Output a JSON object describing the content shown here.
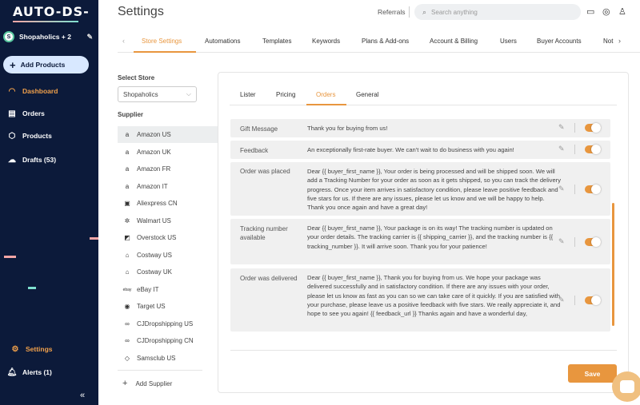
{
  "sidebar": {
    "logo": "AUTO-DS-",
    "store": {
      "avatar": "S",
      "name": "Shopaholics + 2"
    },
    "add_products": "Add Products",
    "nav": [
      {
        "label": "Dashboard",
        "icon": "dashboard-icon",
        "active": true
      },
      {
        "label": "Orders",
        "icon": "orders-icon"
      },
      {
        "label": "Products",
        "icon": "products-icon"
      },
      {
        "label": "Drafts (53)",
        "icon": "drafts-icon"
      }
    ],
    "bottom_nav": [
      {
        "label": "Settings",
        "icon": "settings-icon",
        "active": true
      },
      {
        "label": "Alerts (1)",
        "icon": "alerts-icon"
      }
    ],
    "colors": {
      "background": "#0c1a3a",
      "accent": "#f0a04b"
    }
  },
  "header": {
    "title": "Settings",
    "referrals": "Referrals",
    "search_placeholder": "Search anything"
  },
  "top_tabs": [
    {
      "label": "Store Settings",
      "active": true
    },
    {
      "label": "Automations"
    },
    {
      "label": "Templates"
    },
    {
      "label": "Keywords"
    },
    {
      "label": "Plans & Add-ons"
    },
    {
      "label": "Account & Billing"
    },
    {
      "label": "Users"
    },
    {
      "label": "Buyer Accounts"
    },
    {
      "label": "Not"
    }
  ],
  "store_column": {
    "select_label": "Select Store",
    "selected_store": "Shopaholics",
    "supplier_label": "Supplier",
    "suppliers": [
      {
        "name": "Amazon US",
        "icon": "amazon-icon",
        "active": true
      },
      {
        "name": "Amazon UK",
        "icon": "amazon-icon"
      },
      {
        "name": "Amazon FR",
        "icon": "amazon-icon"
      },
      {
        "name": "Amazon IT",
        "icon": "amazon-icon"
      },
      {
        "name": "Aliexpress CN",
        "icon": "aliexpress-icon"
      },
      {
        "name": "Walmart US",
        "icon": "walmart-icon"
      },
      {
        "name": "Overstock US",
        "icon": "overstock-icon"
      },
      {
        "name": "Costway US",
        "icon": "costway-icon"
      },
      {
        "name": "Costway UK",
        "icon": "costway-icon"
      },
      {
        "name": "eBay IT",
        "icon": "ebay-icon"
      },
      {
        "name": "Target US",
        "icon": "target-icon"
      },
      {
        "name": "CJDropshipping US",
        "icon": "cj-icon"
      },
      {
        "name": "CJDropshipping CN",
        "icon": "cj-icon"
      },
      {
        "name": "Samsclub US",
        "icon": "samsclub-icon"
      }
    ],
    "add_supplier": "Add Supplier"
  },
  "sub_tabs": [
    {
      "label": "Lister"
    },
    {
      "label": "Pricing"
    },
    {
      "label": "Orders",
      "active": true
    },
    {
      "label": "General"
    }
  ],
  "messages": [
    {
      "label": "Gift Message",
      "text": "Thank you for buying from us!",
      "enabled": true
    },
    {
      "label": "Feedback",
      "text": "An exceptionally first-rate buyer. We can't wait to do business with you again!",
      "enabled": true
    },
    {
      "label": "Order was placed",
      "text": "Dear {{ buyer_first_name }}, Your order is being processed and will be shipped soon. We will add a Tracking Number for your order as soon as it gets shipped, so you can track the delivery progress. Once your item arrives in satisfactory condition, please leave positive feedback and five stars for us. If there are any issues, please let us know and we will be happy to help. Thank you once again and have a great day!",
      "enabled": true
    },
    {
      "label": "Tracking number available",
      "text": "Dear {{ buyer_first_name }}, Your package is on its way! The tracking number is updated on your order details. The tracking carrier is {{ shipping_carrier }}, and the tracking number is {{ tracking_number }}. It will arrive soon. Thank you for your patience!",
      "enabled": true
    },
    {
      "label": "Order was delivered",
      "text": "Dear {{ buyer_first_name }}, Thank you for buying from us. We hope your package was delivered successfully and in satisfactory condition. If there are any issues with your order, please let us know as fast as you can so we can take care of it quickly. If you are satisfied with your purchase, please leave us a positive feedback with five stars. We really appreciate it, and hope to see you again! {{ feedback_url }} Thanks again and have a wonderful day,",
      "enabled": true
    }
  ],
  "save_label": "Save",
  "accent_color": "#e8963e"
}
